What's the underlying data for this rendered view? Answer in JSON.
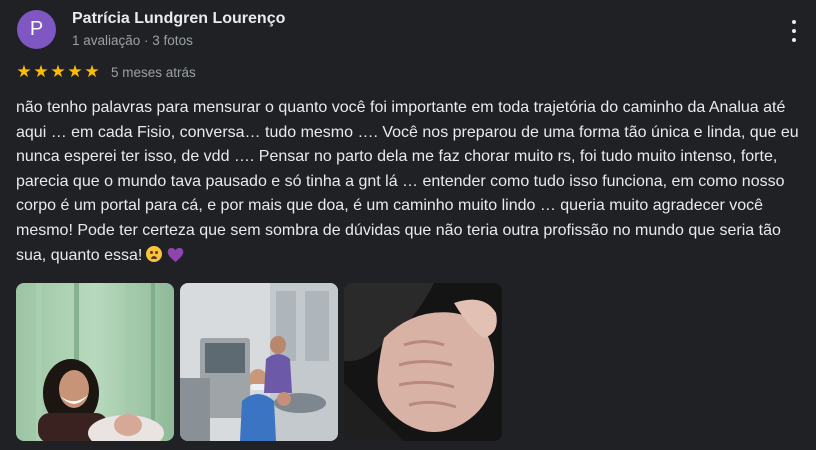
{
  "reviewer": {
    "initial": "P",
    "name": "Patrícia Lundgren Lourenço",
    "meta": "1 avaliação · 3 fotos",
    "avatar_color": "#7e57c2"
  },
  "rating": {
    "stars": 5,
    "max": 5,
    "date": "5 meses atrás",
    "star_color": "#fbbc04"
  },
  "review": {
    "text": "não tenho palavras para mensurar o quanto você foi importante em toda trajetória do caminho da Analua até aqui … em cada Fisio, conversa… tudo mesmo …. Você nos preparou de uma forma tão única e linda, que eu nunca esperei ter isso, de vdd …. Pensar no parto dela me faz chorar muito rs, foi tudo muito intenso, forte, parecia que o mundo tava pausado e só tinha a gnt lá … entender como tudo isso funciona, em como nosso corpo é um portal para cá, e por mais que doa, é um caminho muito lindo … queria muito agradecer você mesmo! Pode ter certeza que sem sombra de dúvidas que não teria outra profissão no mundo que seria tão sua, quanto essa!",
    "emojis": [
      "pleading-face-emoji",
      "purple-heart-emoji"
    ]
  },
  "photos": [
    {
      "icon": "photo-mother-with-newborn"
    },
    {
      "icon": "photo-delivery-room-team"
    },
    {
      "icon": "photo-baby-hand"
    }
  ],
  "icons": {
    "more": "more-vertical-icon",
    "star": "star-icon"
  }
}
